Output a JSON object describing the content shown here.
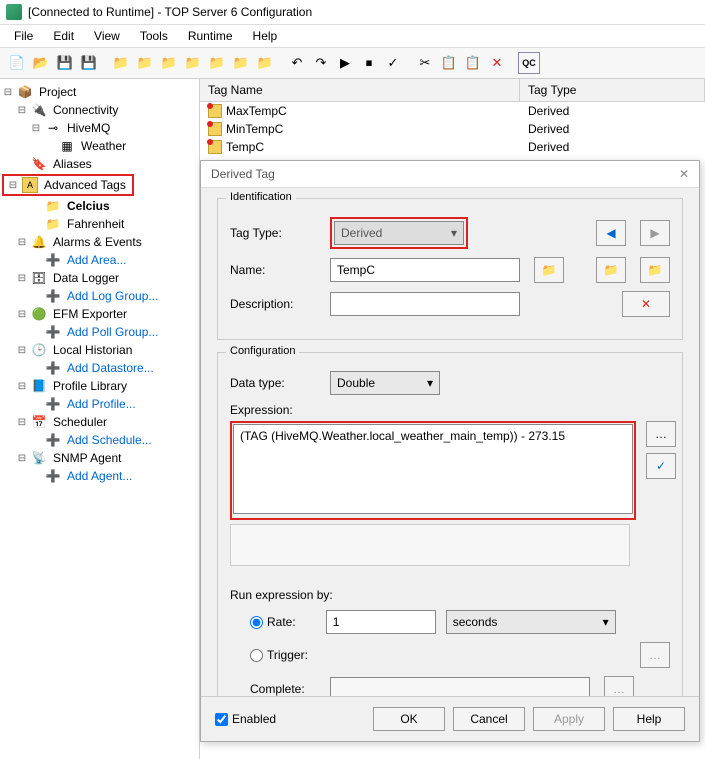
{
  "title": "[Connected to Runtime] - TOP Server 6 Configuration",
  "menu": {
    "file": "File",
    "edit": "Edit",
    "view": "View",
    "tools": "Tools",
    "runtime": "Runtime",
    "help": "Help"
  },
  "tree": {
    "project": "Project",
    "connectivity": "Connectivity",
    "hivemq": "HiveMQ",
    "weather": "Weather",
    "aliases": "Aliases",
    "advtags": "Advanced Tags",
    "celcius": "Celcius",
    "fahrenheit": "Fahrenheit",
    "alarms": "Alarms & Events",
    "addarea": "Add Area...",
    "datalogger": "Data Logger",
    "addlog": "Add Log Group...",
    "efm": "EFM Exporter",
    "addpoll": "Add Poll Group...",
    "localhist": "Local Historian",
    "adddata": "Add Datastore...",
    "profile": "Profile Library",
    "addprofile": "Add Profile...",
    "scheduler": "Scheduler",
    "addsched": "Add Schedule...",
    "snmp": "SNMP Agent",
    "addagent": "Add Agent..."
  },
  "list": {
    "hdr_name": "Tag Name",
    "hdr_type": "Tag Type",
    "rows": [
      {
        "name": "MaxTempC",
        "type": "Derived"
      },
      {
        "name": "MinTempC",
        "type": "Derived"
      },
      {
        "name": "TempC",
        "type": "Derived"
      }
    ]
  },
  "dialog": {
    "title": "Derived Tag",
    "identification": "Identification",
    "tagtype_lbl": "Tag Type:",
    "tagtype_val": "Derived",
    "name_lbl": "Name:",
    "name_val": "TempC",
    "desc_lbl": "Description:",
    "desc_val": "",
    "configuration": "Configuration",
    "datatype_lbl": "Data type:",
    "datatype_val": "Double",
    "expr_lbl": "Expression:",
    "expr_val": "(TAG (HiveMQ.Weather.local_weather_main_temp)) - 273.15",
    "runby": "Run expression by:",
    "rate_lbl": "Rate:",
    "rate_val": "1",
    "rate_unit": "seconds",
    "trigger_lbl": "Trigger:",
    "complete_lbl": "Complete:",
    "enabled": "Enabled",
    "ok": "OK",
    "cancel": "Cancel",
    "apply": "Apply",
    "help": "Help"
  }
}
